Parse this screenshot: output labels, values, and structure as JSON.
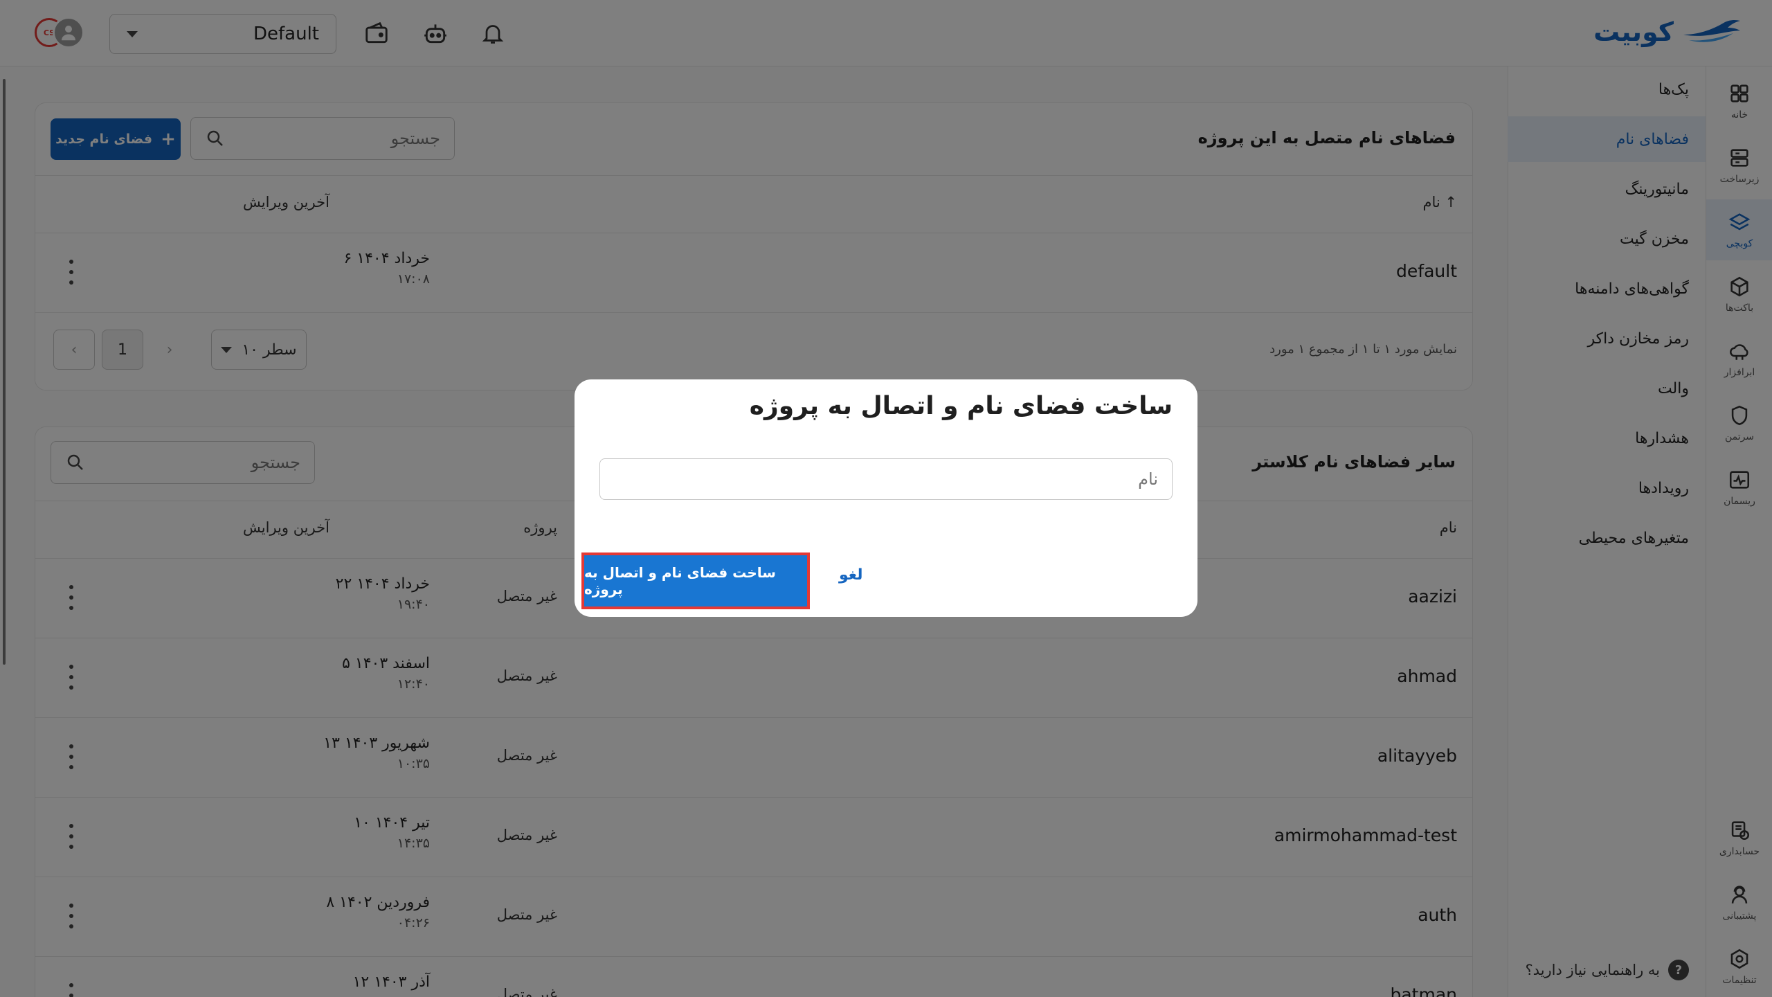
{
  "header": {
    "logo_text": "کوبیت",
    "project_select": {
      "value": "Default"
    },
    "avatar_badge": "CS"
  },
  "sidebar": {
    "rail": [
      {
        "label": "خانه",
        "icon": "grid-icon"
      },
      {
        "label": "زیرساخت",
        "icon": "server-icon"
      },
      {
        "label": "کوبچی",
        "icon": "layers-icon",
        "active": true
      },
      {
        "label": "باکت‌ها",
        "icon": "cube-icon"
      },
      {
        "label": "ابرافزار",
        "icon": "cloud-app-icon"
      },
      {
        "label": "سرتمن",
        "icon": "shield-icon"
      },
      {
        "label": "ریسمان",
        "icon": "pulse-icon"
      },
      {
        "label": "حسابداری",
        "icon": "billing-icon"
      },
      {
        "label": "پشتیبانی",
        "icon": "support-icon"
      },
      {
        "label": "تنظیمات",
        "icon": "gear-icon"
      }
    ],
    "submenu": [
      {
        "label": "پک‌ها"
      },
      {
        "label": "فضاهای نام",
        "active": true
      },
      {
        "label": "مانیتورینگ"
      },
      {
        "label": "مخزن گیت"
      },
      {
        "label": "گواهی‌های دامنه‌ها"
      },
      {
        "label": "رمز مخازن داکر"
      },
      {
        "label": "والت"
      },
      {
        "label": "هشدارها"
      },
      {
        "label": "رویدادها"
      },
      {
        "label": "متغیرهای محیطی"
      }
    ],
    "help_text": "به راهنمایی نیاز دارید؟"
  },
  "connected": {
    "title": "فضاهای نام متصل به این پروژه",
    "search_placeholder": "جستجو",
    "new_button": "فضای نام جدید",
    "columns": {
      "name": "نام",
      "last_edit": "آخرین ویرایش"
    },
    "rows": [
      {
        "name": "default",
        "date": "۶ خرداد ۱۴۰۴",
        "time": "۱۷:۰۸"
      }
    ],
    "pagination": {
      "summary": "نمایش مورد ۱ تا ۱ از مجموع ۱ مورد",
      "rows_per_page": "۱۰ سطر",
      "page": "1"
    }
  },
  "others": {
    "title": "سایر فضاهای نام کلاستر",
    "search_placeholder": "جستجو",
    "columns": {
      "name": "نام",
      "project": "پروژه",
      "last_edit": "آخرین ویرایش"
    },
    "rows": [
      {
        "name": "aazizi",
        "project": "غیر متصل",
        "date": "۲۲ خرداد ۱۴۰۴",
        "time": "۱۹:۴۰"
      },
      {
        "name": "ahmad",
        "project": "غیر متصل",
        "date": "۵ اسفند ۱۴۰۳",
        "time": "۱۲:۴۰"
      },
      {
        "name": "alitayyeb",
        "project": "غیر متصل",
        "date": "۱۳ شهریور ۱۴۰۳",
        "time": "۱۰:۳۵"
      },
      {
        "name": "amirmohammad-test",
        "project": "غیر متصل",
        "date": "۱۰ تیر ۱۴۰۴",
        "time": "۱۴:۳۵"
      },
      {
        "name": "auth",
        "project": "غیر متصل",
        "date": "۸ فروردین ۱۴۰۲",
        "time": "۰۴:۲۶"
      },
      {
        "name": "batman",
        "project": "غیر متصل",
        "date": "۱۲ آذر ۱۴۰۳",
        "time": ""
      }
    ]
  },
  "dialog": {
    "title": "ساخت فضای نام و اتصال به پروژه",
    "name_placeholder": "نام",
    "cancel_label": "لغو",
    "confirm_label": "ساخت فضای نام و اتصال به پروژه"
  },
  "colors": {
    "primary": "#1565c0",
    "highlight": "#e53935",
    "overlay": "rgba(0,0,0,0.5)"
  }
}
